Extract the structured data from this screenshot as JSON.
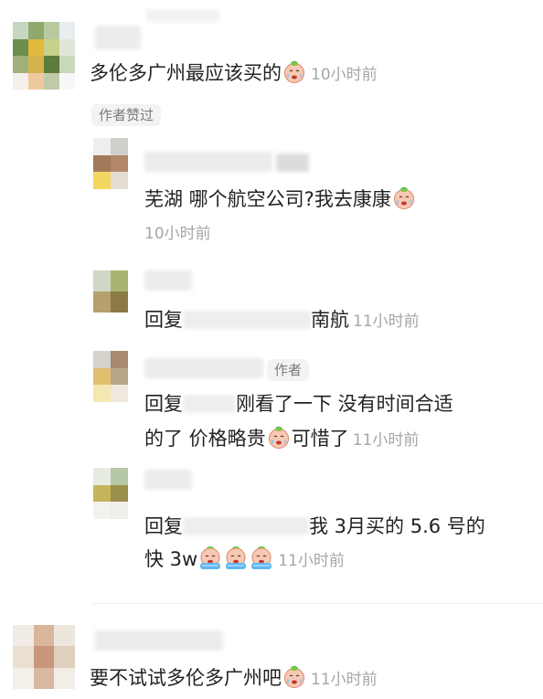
{
  "comments": [
    {
      "text": "多伦多广州最应该买的",
      "time": "10小时前",
      "tag": "作者赞过",
      "replies": [
        {
          "text": "芜湖 哪个航空公司?我去康康",
          "time": "10小时前"
        },
        {
          "prefix": "回复",
          "text": "南航",
          "time": "11小时前"
        },
        {
          "tag": "作者",
          "prefix": "回复",
          "line1": "刚看了一下 没有时间合适",
          "line2a": "的了 价格略贵",
          "line2b": "可惜了",
          "time": "11小时前"
        },
        {
          "prefix": "回复",
          "line1": "我 3月买的 5.6 号的",
          "line2": "快 3w",
          "time": "11小时前"
        }
      ]
    },
    {
      "text": "要不试试多伦多广州吧",
      "time": "11小时前"
    }
  ],
  "icons": {
    "emoji_sad": "crying-face-emoji",
    "emoji_tears": "tears-face-emoji"
  }
}
